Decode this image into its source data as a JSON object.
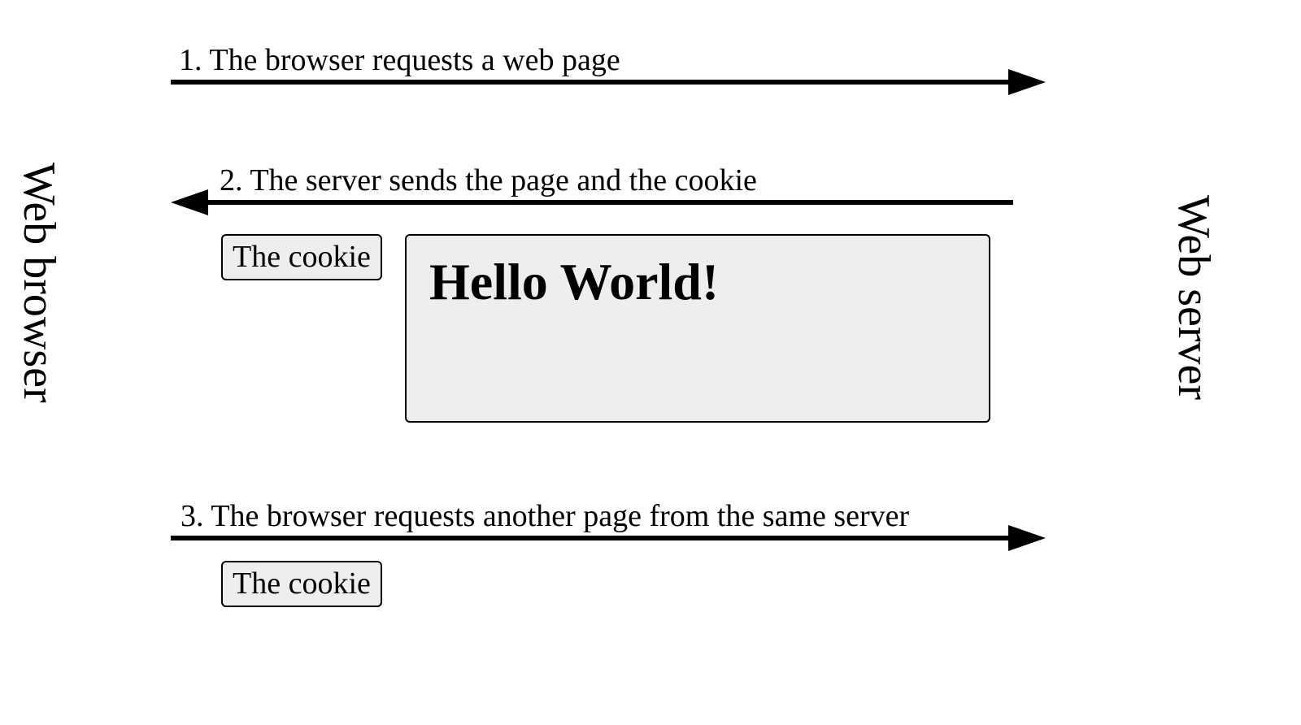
{
  "left_label": "Web browser",
  "right_label": "Web server",
  "step1": {
    "label": "1. The browser requests a web page"
  },
  "step2": {
    "label": "2. The server sends the page and the cookie",
    "cookie_label": "The cookie",
    "page_content": "Hello World!"
  },
  "step3": {
    "label": "3. The browser requests another page from the same server",
    "cookie_label": "The cookie"
  }
}
